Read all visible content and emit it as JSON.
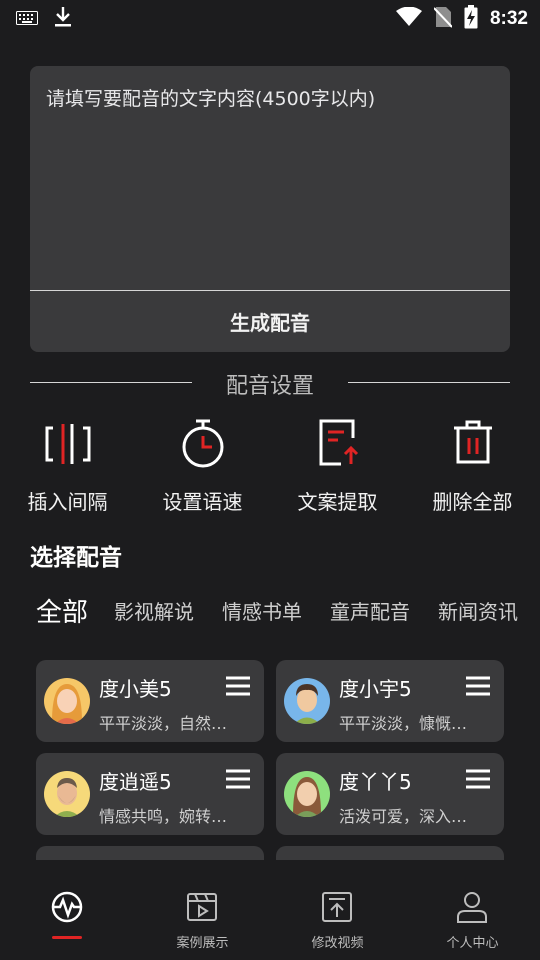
{
  "status_bar": {
    "time": "8:32",
    "icons": [
      "keyboard-icon",
      "download-icon",
      "wifi-icon",
      "no-sim-icon",
      "battery-charging-icon"
    ]
  },
  "editor": {
    "placeholder": "请填写要配音的文字内容(4500字以内)",
    "value": "",
    "generate_label": "生成配音"
  },
  "settings": {
    "title": "配音设置",
    "tools": [
      {
        "label": "插入间隔",
        "icon": "insert-pause-icon"
      },
      {
        "label": "设置语速",
        "icon": "stopwatch-icon"
      },
      {
        "label": "文案提取",
        "icon": "document-extract-icon"
      },
      {
        "label": "删除全部",
        "icon": "trash-icon"
      }
    ]
  },
  "voice_select": {
    "title": "选择配音",
    "tabs": [
      "全部",
      "影视解说",
      "情感书单",
      "童声配音",
      "新闻资讯"
    ],
    "active_tab": "全部",
    "voices": [
      {
        "name": "度小美5",
        "desc": "平平淡淡，自然…",
        "avatar": "female-avatar-blonde"
      },
      {
        "name": "度小宇5",
        "desc": "平平淡淡，慷慨…",
        "avatar": "male-avatar-blue"
      },
      {
        "name": "度逍遥5",
        "desc": "情感共鸣，婉转…",
        "avatar": "male-avatar-beard"
      },
      {
        "name": "度丫丫5",
        "desc": "活泼可爱，深入…",
        "avatar": "female-avatar-green"
      }
    ]
  },
  "bottom_nav": {
    "items": [
      {
        "label": "",
        "icon": "waveform-icon",
        "active": true
      },
      {
        "label": "案例展示",
        "icon": "video-play-icon",
        "active": false
      },
      {
        "label": "修改视频",
        "icon": "upload-box-icon",
        "active": false
      },
      {
        "label": "个人中心",
        "icon": "person-icon",
        "active": false
      }
    ]
  },
  "colors": {
    "background": "#1c1c1e",
    "card": "#3a3a3c",
    "accent": "#e02424"
  }
}
